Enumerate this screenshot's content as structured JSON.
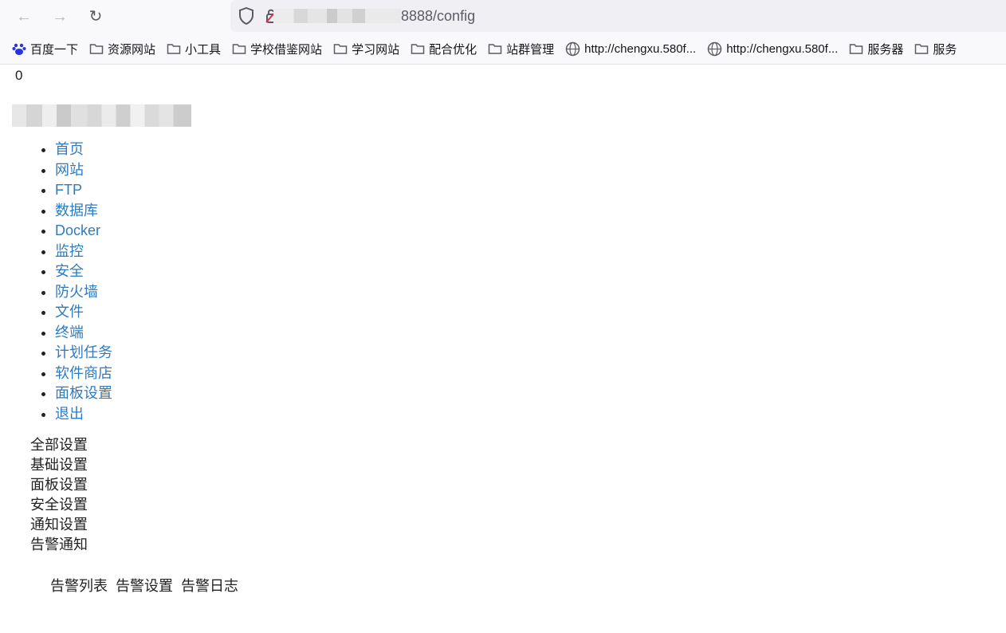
{
  "browser": {
    "url_visible": "8888/config",
    "bookmarks": [
      {
        "label": "百度一下",
        "icon": "baidu-icon"
      },
      {
        "label": "资源网站",
        "icon": "folder-icon"
      },
      {
        "label": "小工具",
        "icon": "folder-icon"
      },
      {
        "label": "学校借鉴网站",
        "icon": "folder-icon"
      },
      {
        "label": "学习网站",
        "icon": "folder-icon"
      },
      {
        "label": "配合优化",
        "icon": "folder-icon"
      },
      {
        "label": "站群管理",
        "icon": "folder-icon"
      },
      {
        "label": "http://chengxu.580f...",
        "icon": "globe-icon"
      },
      {
        "label": "http://chengxu.580f...",
        "icon": "globe-icon"
      },
      {
        "label": "服务器",
        "icon": "folder-icon"
      },
      {
        "label": "服务",
        "icon": "folder-icon"
      }
    ]
  },
  "page": {
    "counter": "0",
    "nav": [
      {
        "label": "首页"
      },
      {
        "label": "网站"
      },
      {
        "label": "FTP"
      },
      {
        "label": "数据库"
      },
      {
        "label": "Docker"
      },
      {
        "label": "监控"
      },
      {
        "label": "安全"
      },
      {
        "label": "防火墙"
      },
      {
        "label": "文件"
      },
      {
        "label": "终端"
      },
      {
        "label": "计划任务"
      },
      {
        "label": "软件商店"
      },
      {
        "label": "面板设置"
      },
      {
        "label": "退出"
      }
    ],
    "settings_menu": [
      {
        "label": "全部设置"
      },
      {
        "label": "基础设置"
      },
      {
        "label": "面板设置"
      },
      {
        "label": "安全设置"
      },
      {
        "label": "通知设置"
      },
      {
        "label": "告警通知"
      }
    ],
    "alert_tabs": [
      {
        "label": "告警列表"
      },
      {
        "label": "告警设置"
      },
      {
        "label": "告警日志"
      }
    ]
  },
  "colors": {
    "link": "#2f7bbf",
    "text": "#222222",
    "chrome": "#f9f9fb",
    "url_bar": "#f0f0f4"
  }
}
